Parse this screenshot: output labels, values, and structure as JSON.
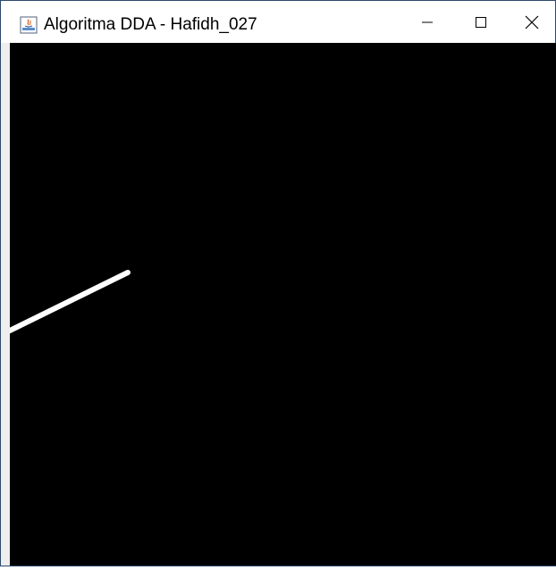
{
  "window": {
    "title": "Algoritma DDA - Hafidh_027",
    "app_icon": "java-icon",
    "controls": {
      "minimize_icon": "minimize-icon",
      "maximize_icon": "maximize-icon",
      "close_icon": "close-icon"
    }
  },
  "canvas": {
    "background": "#000000",
    "line_color": "#ffffff"
  }
}
